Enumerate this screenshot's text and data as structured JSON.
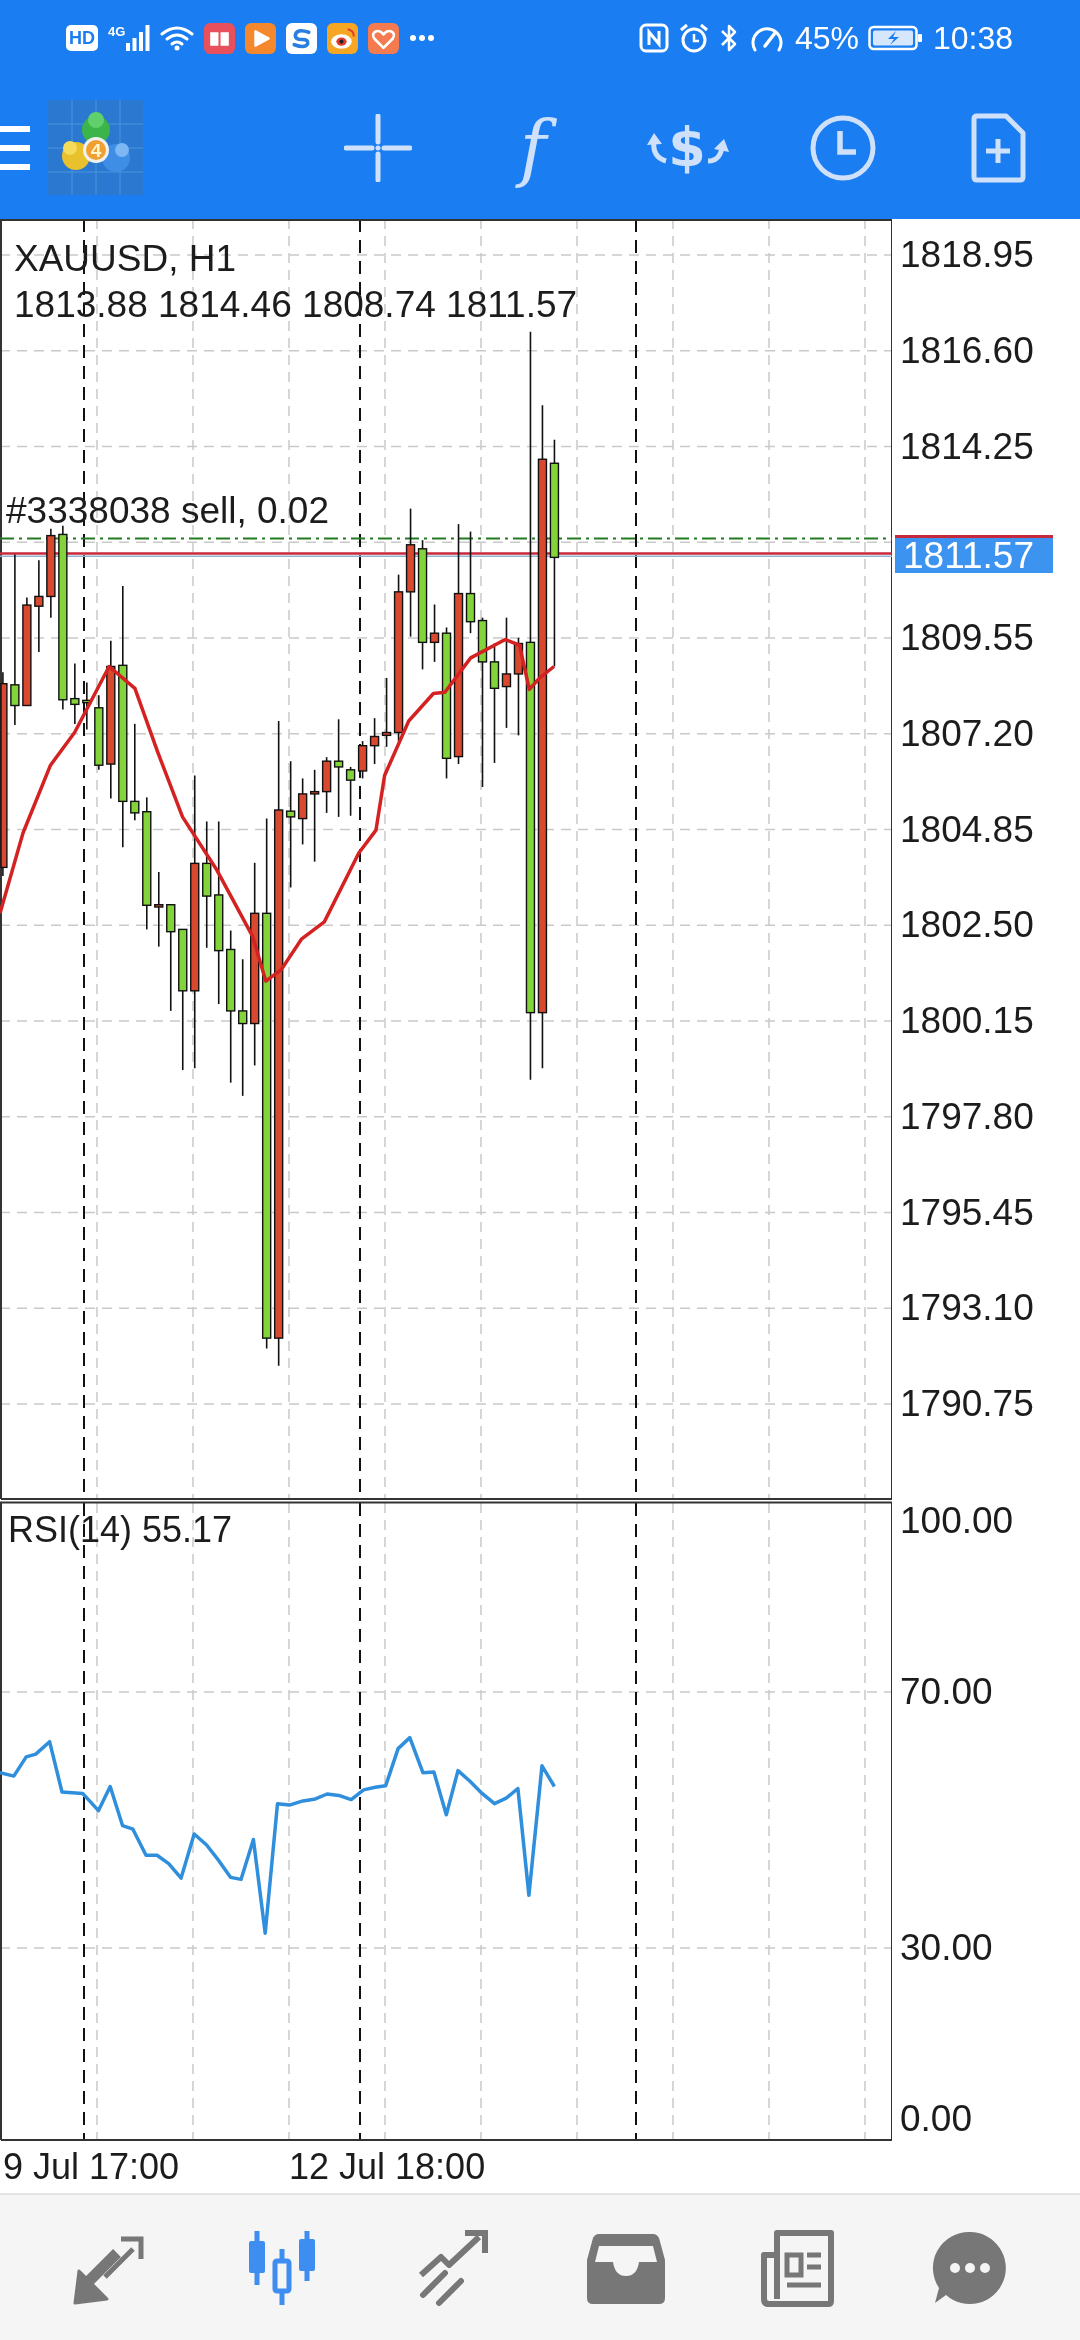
{
  "status_bar": {
    "badge": "HD",
    "network": "4G",
    "battery": "45%",
    "time": "10:38"
  },
  "toolbar": {
    "logo_badge": "4",
    "buttons": [
      {
        "kind": "crosshair"
      },
      {
        "kind": "indicators",
        "glyph": "f"
      },
      {
        "kind": "trade",
        "glyph": "$"
      },
      {
        "kind": "period"
      },
      {
        "kind": "new_order"
      }
    ]
  },
  "chart": {
    "symbol": "XAUUSD, H1",
    "ohlc": "1813.88 1814.46 1808.74 1811.57",
    "order_label": "#3338038 sell, 0.02",
    "price_tag": "1811.57",
    "price_axis": [
      "1818.95",
      "1816.60",
      "1814.25",
      "1809.55",
      "1807.20",
      "1804.85",
      "1802.50",
      "1800.15",
      "1797.80",
      "1795.45",
      "1793.10",
      "1790.75"
    ]
  },
  "indicator": {
    "label": "RSI(14) 55.17",
    "axis": [
      "100.00",
      "70.00",
      "30.00",
      "0.00"
    ]
  },
  "time_axis": [
    "9 Jul 17:00",
    "12 Jul 18:00"
  ],
  "bottom_nav": [
    {
      "kind": "quotes",
      "selected": false
    },
    {
      "kind": "chart",
      "selected": true
    },
    {
      "kind": "trade",
      "selected": false
    },
    {
      "kind": "history",
      "selected": false
    },
    {
      "kind": "news",
      "selected": false
    },
    {
      "kind": "chat",
      "selected": false
    }
  ]
}
